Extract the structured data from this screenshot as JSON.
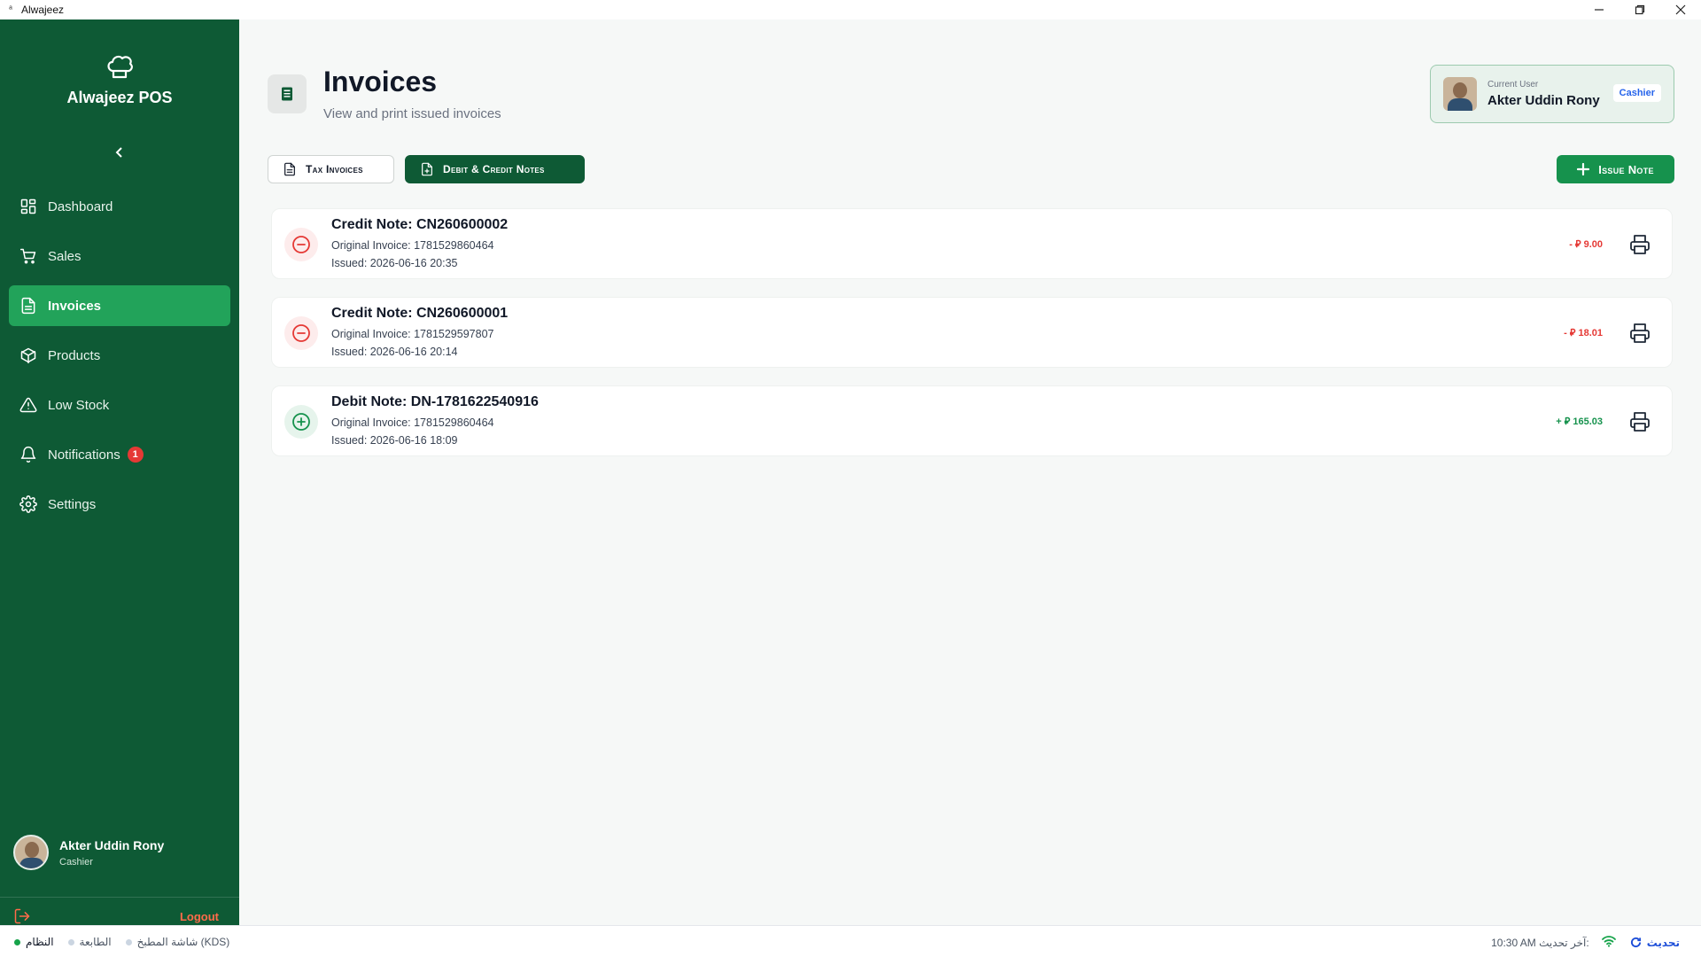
{
  "window": {
    "title": "Alwajeez"
  },
  "sidebar": {
    "brand": "Alwajeez POS",
    "items": [
      {
        "label": "Dashboard",
        "icon": "dashboard-icon"
      },
      {
        "label": "Sales",
        "icon": "cart-icon"
      },
      {
        "label": "Invoices",
        "icon": "invoice-icon",
        "active": true
      },
      {
        "label": "Products",
        "icon": "box-icon"
      },
      {
        "label": "Low Stock",
        "icon": "warning-icon"
      },
      {
        "label": "Notifications",
        "icon": "bell-icon",
        "badge": "1"
      },
      {
        "label": "Settings",
        "icon": "gear-icon"
      }
    ],
    "user": {
      "name": "Akter Uddin Rony",
      "role": "Cashier"
    },
    "logout_label": "Logout"
  },
  "header": {
    "title": "Invoices",
    "subtitle": "View and print issued invoices"
  },
  "current_user": {
    "label": "Current User",
    "name": "Akter Uddin Rony",
    "role": "Cashier"
  },
  "tabs": {
    "tax_invoices": "Tax Invoices",
    "debit_credit_notes": "Debit & Credit Notes"
  },
  "issue_note_label": "Issue Note",
  "notes": [
    {
      "title": "Credit Note: CN260600002",
      "original_invoice": "Original Invoice: 1781529860464",
      "issued": "Issued: 2026-06-16 20:35",
      "amount": "- ⃁ 9.00",
      "type": "credit"
    },
    {
      "title": "Credit Note: CN260600001",
      "original_invoice": "Original Invoice: 1781529597807",
      "issued": "Issued: 2026-06-16 20:14",
      "amount": "- ⃁ 18.01",
      "type": "credit"
    },
    {
      "title": "Debit Note: DN-1781622540916",
      "original_invoice": "Original Invoice: 1781529860464",
      "issued": "Issued: 2026-06-16 18:09",
      "amount": "+ ⃁ 165.03",
      "type": "debit"
    }
  ],
  "statusbar": {
    "system": "النظام",
    "printer": "الطابعة",
    "kds": "شاشة المطبخ (KDS)",
    "last_update": "10:30 AM آخر تحديث:",
    "refresh": "تحديث"
  },
  "colors": {
    "sidebar_bg": "#0e5a35",
    "active_nav": "#22a35a",
    "primary_button": "#16924d",
    "credit": "#e53935",
    "debit": "#16924d",
    "logout": "#ff6b4a"
  }
}
